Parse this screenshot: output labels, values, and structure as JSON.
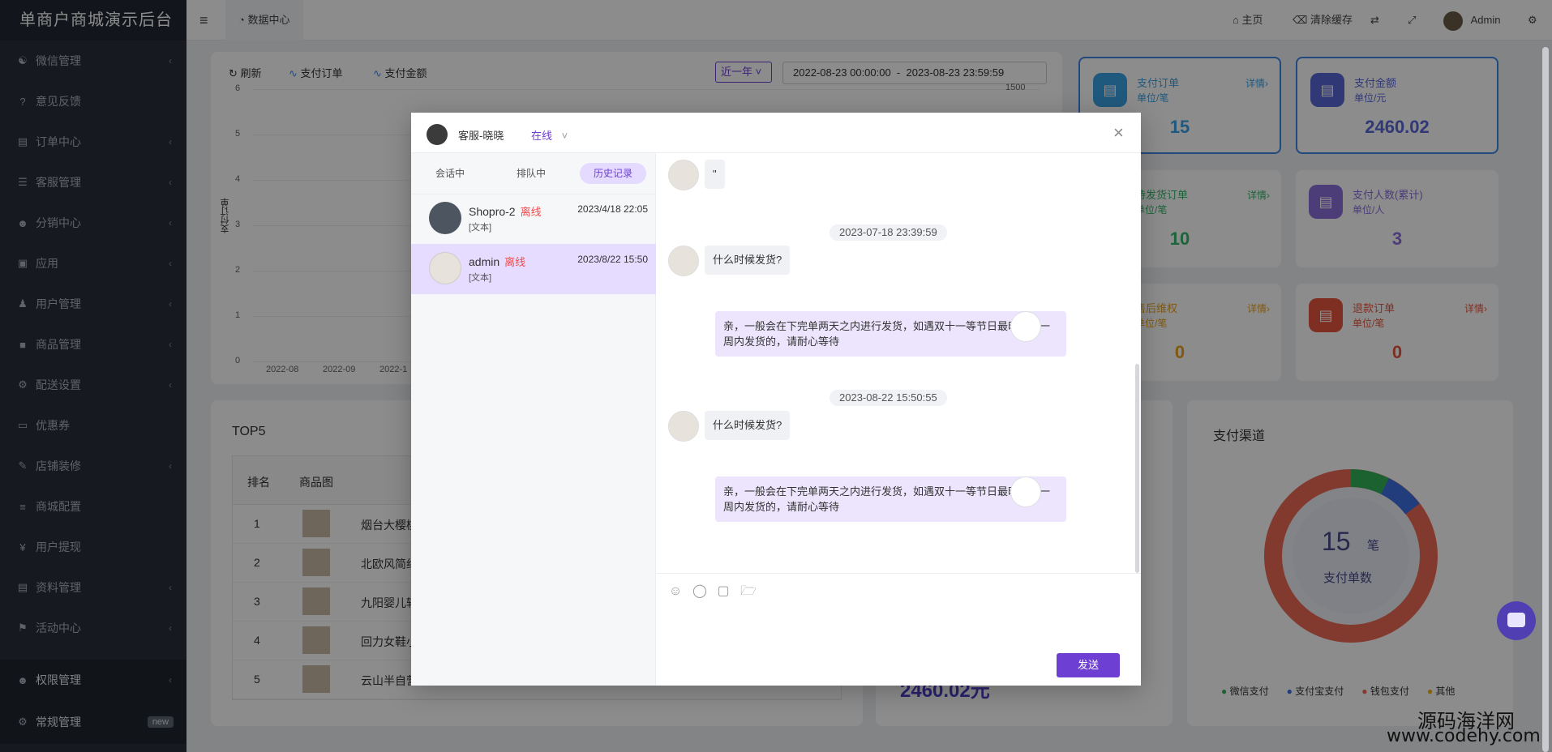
{
  "app": {
    "brand": "单商户商城演示后台"
  },
  "sidebar": {
    "items": [
      {
        "label": "微信管理",
        "icon": "wechat-icon",
        "chev": "‹"
      },
      {
        "label": "意见反馈",
        "icon": "question-icon",
        "chev": ""
      },
      {
        "label": "订单中心",
        "icon": "file-icon",
        "chev": "‹"
      },
      {
        "label": "客服管理",
        "icon": "list-icon",
        "chev": "‹"
      },
      {
        "label": "分销中心",
        "icon": "users-icon",
        "chev": "‹"
      },
      {
        "label": "应用",
        "icon": "briefcase-icon",
        "chev": "‹"
      },
      {
        "label": "用户管理",
        "icon": "user-icon",
        "chev": "‹"
      },
      {
        "label": "商品管理",
        "icon": "box-icon",
        "chev": "‹"
      },
      {
        "label": "配送设置",
        "icon": "gears-icon",
        "chev": "‹"
      },
      {
        "label": "优惠券",
        "icon": "ticket-icon",
        "chev": ""
      },
      {
        "label": "店铺装修",
        "icon": "brush-icon",
        "chev": "‹"
      },
      {
        "label": "商城配置",
        "icon": "sliders-icon",
        "chev": ""
      },
      {
        "label": "用户提现",
        "icon": "yen-icon",
        "chev": ""
      },
      {
        "label": "资料管理",
        "icon": "doc-icon",
        "chev": "‹"
      },
      {
        "label": "活动中心",
        "icon": "flag-icon",
        "chev": "‹"
      }
    ],
    "bottom": [
      {
        "label": "权限管理",
        "chev": "‹"
      },
      {
        "label": "常规管理",
        "badge": "new"
      }
    ]
  },
  "header": {
    "menu_icon": "≡",
    "tab": "数据中心",
    "home": "主页",
    "clear_cache": "清除缓存",
    "user": "Admin"
  },
  "dashboard": {
    "refresh": "刷新",
    "legend_orders": "支付订单",
    "legend_amount": "支付金额",
    "range_select": "近一年",
    "date_range": "2022-08-23 00:00:00  -  2023-08-23 23:59:59",
    "y_axis_label": "支付订单",
    "y_ticks": [
      "6",
      "5",
      "4",
      "3",
      "2",
      "1",
      "0"
    ],
    "y_right_top": "1500",
    "x_ticks": [
      "2022-08",
      "2022-09",
      "2022-1"
    ],
    "top5_title": "TOP5",
    "top5_headers": [
      "排名",
      "商品图"
    ],
    "top5_rows": [
      {
        "rank": "1",
        "name": "烟台大樱桃"
      },
      {
        "rank": "2",
        "name": "北欧风简约"
      },
      {
        "rank": "3",
        "name": "九阳婴儿辅"
      },
      {
        "rank": "4",
        "name": "回力女鞋小"
      },
      {
        "rank": "5",
        "name": "云山半自营"
      }
    ],
    "bottom_amount": "2460.02元",
    "cards": [
      {
        "title": "支付订单",
        "unit": "单位/笔",
        "value": "15",
        "detail": "详情›",
        "color": "#3ba2e6"
      },
      {
        "title": "支付金额",
        "unit": "单位/元",
        "value": "2460.02",
        "detail": "",
        "color": "#5a67d8"
      },
      {
        "title": "待发货订单",
        "unit": "单位/笔",
        "value": "10",
        "detail": "详情›",
        "color": "#35b76a"
      },
      {
        "title": "支付人数(累计)",
        "unit": "单位/人",
        "value": "3",
        "detail": "",
        "color": "#8b6ddb"
      },
      {
        "title": "售后维权",
        "unit": "单位/笔",
        "value": "0",
        "detail": "详情›",
        "color": "#e9a21b"
      },
      {
        "title": "退款订单",
        "unit": "单位/笔",
        "value": "0",
        "detail": "详情›",
        "color": "#e8563f"
      }
    ],
    "pay_channel": {
      "title": "支付渠道",
      "center_value": "15",
      "center_unit": "笔",
      "center_label": "支付单数",
      "legend": [
        {
          "name": "微信支付",
          "color": "#34b35a"
        },
        {
          "name": "支付宝支付",
          "color": "#3d6fe0"
        },
        {
          "name": "钱包支付",
          "color": "#ee6a55"
        },
        {
          "name": "其他",
          "color": "#f5b400"
        }
      ]
    }
  },
  "modal": {
    "agent_name": "客服-晓晓",
    "status": "在线",
    "close": "×",
    "tabs": [
      "会话中",
      "排队中",
      "历史记录"
    ],
    "conversations": [
      {
        "name": "Shopro-2",
        "status": "离线",
        "time": "2023/4/18 22:05",
        "preview": "[文本]"
      },
      {
        "name": "admin",
        "status": "离线",
        "time": "2023/8/22 15:50",
        "preview": "[文本]"
      }
    ],
    "messages": {
      "first": "\"",
      "time1": "2023-07-18 23:39:59",
      "q1": "什么时候发货?",
      "a1": "亲，一般会在下完单两天之内进行发货，如遇双十一等节日最晚会在一周内发货的，请耐心等待",
      "time2": "2023-08-22 15:50:55",
      "q2": "什么时候发货?",
      "a2": "亲，一般会在下完单两天之内进行发货，如遇双十一等节日最晚会在一周内发货的，请耐心等待"
    },
    "send": "发送"
  },
  "watermark": {
    "line1": "源码海洋网",
    "line2": "www.codehy.com"
  }
}
